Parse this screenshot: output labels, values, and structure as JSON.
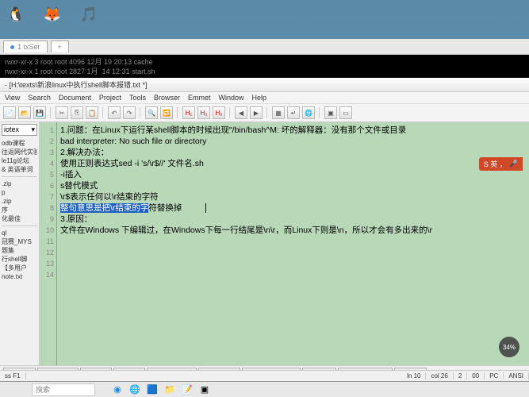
{
  "desktop_icons": [
    "🐧",
    "🦊",
    "🎵"
  ],
  "terminal": {
    "tab": "1 txSer",
    "lines": [
      "rwxr-xr-x 3 root root 4096 12月 19 20:13 cache",
      "rwxr-xr-x 1 root root 2827 1月  14 12:31 start.sh"
    ]
  },
  "editor": {
    "title": "- [H:\\texts\\新浪linux中执行shell脚本报错.txt *]",
    "menus": [
      "View",
      "Search",
      "Document",
      "Project",
      "Tools",
      "Browser",
      "Emmet",
      "Window",
      "Help"
    ],
    "combo": "iotex",
    "side_items1": [
      "odb课程",
      "往返网代实验",
      "le11g论坛",
      "",
      "& 英语单词"
    ],
    "side_items2": [
      ".zip",
      "p",
      ".zip",
      "序",
      "化最佳",
      "ql",
      "冠赛_MYS",
      "题集",
      "行shell脚",
      "【多用户",
      "note.txt"
    ],
    "lines": {
      "l1": "1.问题：在Linux下运行某shell脚本的时候出现\"/bin/bash^M: 坏的解释器：没有那个文件或目录",
      "l2": "bad interpreter: No such file or directory",
      "l3": "",
      "l4": "2.解决办法：",
      "l5": "使用正则表达式sed -i 's/\\r$//' 文件名.sh",
      "l6": "",
      "l7": "-i插入",
      "l8": "s替代模式",
      "l9a": "\\r$表示任何以\\r结束的字符",
      "l9b": "",
      "l10": "整句意思是把\\r结束的字",
      "l10b": "符替换掉",
      "l11": "",
      "l12": "3.原因：",
      "l13": "文件在Windows 下编辑过，在Windows下每一行结尾是\\n\\r，而Linux下则是\\n，所以才会有多出来的\\r"
    },
    "filetabs": [
      "note.bt",
      "note tai.bt",
      "new.bt",
      "add.txt",
      "serverinfo.txt",
      "index.html",
      "新建文本文档-ja",
      "note.txt",
      "新建文本文档-j",
      "note.bt"
    ]
  },
  "status": {
    "left": "ss F1",
    "ln": "ln 10",
    "col": "col 26",
    "sel": "2",
    "pos": "00",
    "enc": "PC",
    "eol": "ANSI"
  },
  "search_ph": "搜索",
  "ime": "S 英 ，",
  "pct": "34%"
}
